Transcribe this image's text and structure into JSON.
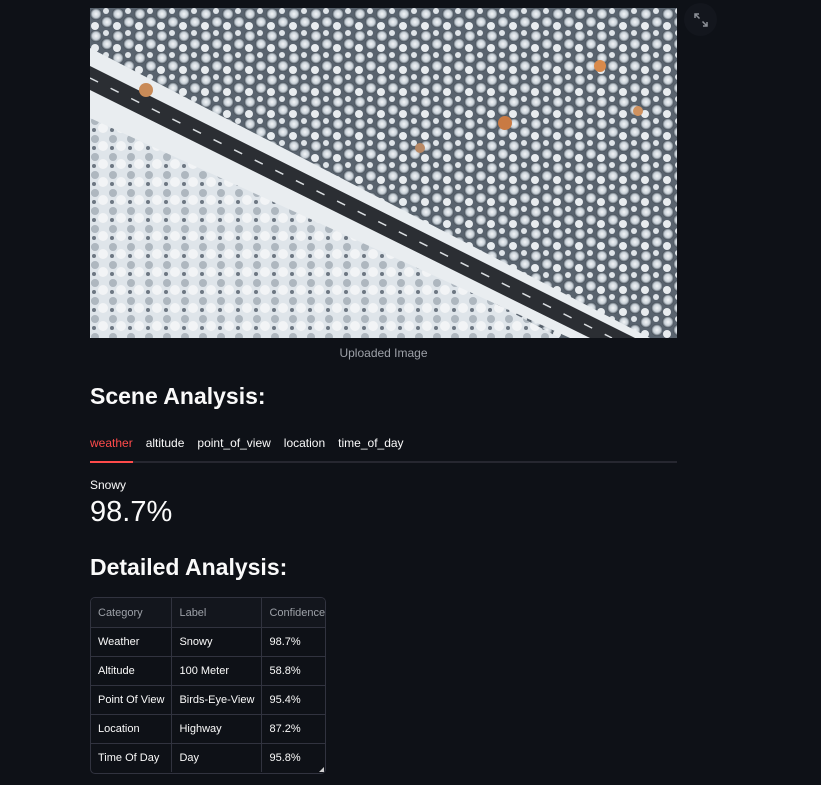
{
  "image": {
    "caption": "Uploaded Image"
  },
  "fullscreen_icon": "expand-icon",
  "scene_analysis": {
    "heading": "Scene Analysis:",
    "tabs": [
      {
        "label": "weather",
        "active": true
      },
      {
        "label": "altitude",
        "active": false
      },
      {
        "label": "point_of_view",
        "active": false
      },
      {
        "label": "location",
        "active": false
      },
      {
        "label": "time_of_day",
        "active": false
      }
    ],
    "metric": {
      "label": "Snowy",
      "value": "98.7%"
    }
  },
  "detailed_analysis": {
    "heading": "Detailed Analysis:",
    "columns": [
      "Category",
      "Label",
      "Confidence"
    ],
    "rows": [
      [
        "Weather",
        "Snowy",
        "98.7%"
      ],
      [
        "Altitude",
        "100 Meter",
        "58.8%"
      ],
      [
        "Point Of View",
        "Birds-Eye-View",
        "95.4%"
      ],
      [
        "Location",
        "Highway",
        "87.2%"
      ],
      [
        "Time Of Day",
        "Day",
        "95.8%"
      ]
    ]
  },
  "colors": {
    "background": "#0e1117",
    "accent": "#ff4b4b",
    "border": "#31333f"
  }
}
